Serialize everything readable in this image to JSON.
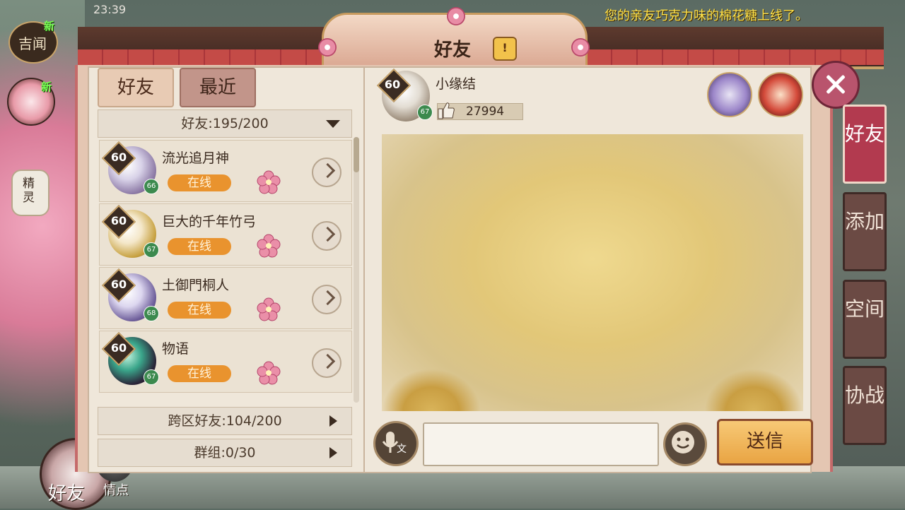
{
  "status": {
    "time": "23:39"
  },
  "notice": "您的亲友巧克力味的棉花糖上线了。",
  "title": "好友",
  "left_menu": {
    "jiwen_label": "吉闻",
    "jiwen_new": "新",
    "cake_new": "新",
    "spirit_label": "精灵",
    "friends_label": "好友",
    "spot_label": "情点"
  },
  "tabs": [
    {
      "label": "好友"
    },
    {
      "label": "最近"
    }
  ],
  "friends_section": {
    "label": "好友:195/200"
  },
  "friends": [
    {
      "name": "流光追月神",
      "level": "60",
      "sub_level": "66",
      "status": "在线"
    },
    {
      "name": "巨大的千年竹弓",
      "level": "60",
      "sub_level": "67",
      "status": "在线"
    },
    {
      "name": "土御門桐人",
      "level": "60",
      "sub_level": "68",
      "status": "在线"
    },
    {
      "name": "物语",
      "level": "60",
      "sub_level": "67",
      "status": "在线"
    }
  ],
  "cross_server": {
    "label": "跨区好友:104/200"
  },
  "groups": {
    "label": "群组:0/30"
  },
  "chat": {
    "name": "小缘结",
    "level": "60",
    "sub_level": "67",
    "likes": "27994",
    "input_placeholder": "",
    "send_label": "送信",
    "voice_label": "文"
  },
  "side_tabs": [
    {
      "label": "好友",
      "active": true
    },
    {
      "label": "添加",
      "active": false
    },
    {
      "label": "空间",
      "active": false
    },
    {
      "label": "协战",
      "active": false
    }
  ],
  "colors": {
    "accent": "#b23a4f",
    "online": "#e9932e",
    "notice": "#ffe34a",
    "new": "#7bff57"
  }
}
